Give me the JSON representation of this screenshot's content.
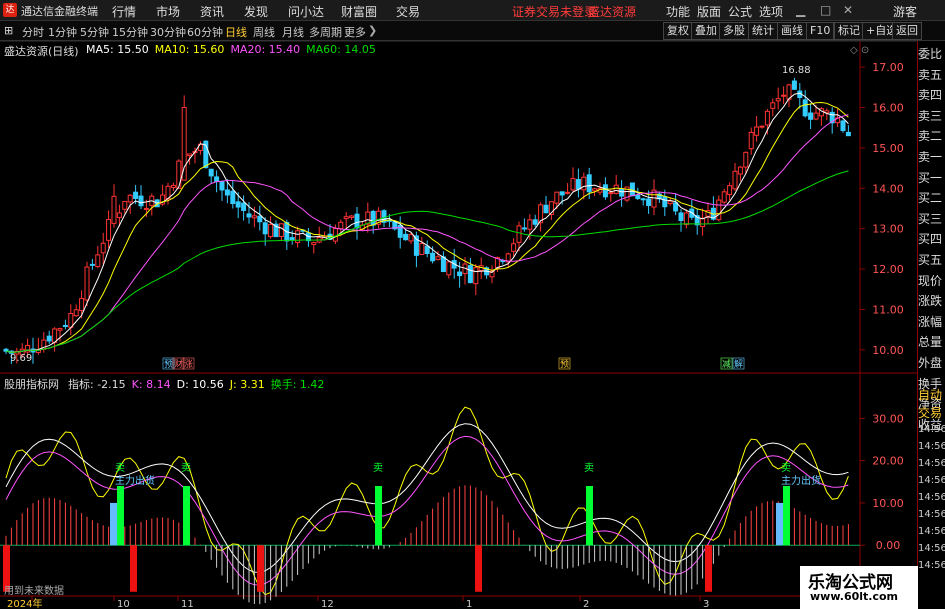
{
  "app": {
    "title": "通达信金融终端",
    "logo": "达",
    "status_alert": "证券交易未登录",
    "brand_link": "盛达资源",
    "user_button": "游客"
  },
  "menu": [
    "行情",
    "市场",
    "资讯",
    "发现",
    "问小达",
    "财富圈",
    "交易"
  ],
  "top_right": [
    "功能",
    "版面",
    "公式",
    "选项"
  ],
  "periods": [
    {
      "label": "分时",
      "active": false
    },
    {
      "label": "1分钟",
      "active": false
    },
    {
      "label": "5分钟",
      "active": false
    },
    {
      "label": "15分钟",
      "active": false
    },
    {
      "label": "30分钟",
      "active": false
    },
    {
      "label": "60分钟",
      "active": false
    },
    {
      "label": "日线",
      "active": true
    },
    {
      "label": "周线",
      "active": false
    },
    {
      "label": "月线",
      "active": false
    },
    {
      "label": "多周期",
      "active": false
    },
    {
      "label": "更多",
      "active": false
    }
  ],
  "toolbar_right": [
    "复权",
    "叠加",
    "多股",
    "统计",
    "画线",
    "F10",
    "标记",
    "+自选",
    "返回"
  ],
  "sidebar": [
    "委比",
    "卖五",
    "卖四",
    "卖三",
    "卖二",
    "卖一",
    "买一",
    "买二",
    "买三",
    "买四",
    "买五",
    "现价",
    "涨跌",
    "涨幅",
    "总量",
    "外盘",
    "换手",
    "净资",
    "收益"
  ],
  "sidebar_bottom": [
    "自动",
    "交易"
  ],
  "time_ticks": [
    "14:56",
    "14:56",
    "14:56",
    "14:56",
    "14:56",
    "14:56",
    "14:56",
    "14:56",
    "14:56"
  ],
  "colors": {
    "ma5": "#ffffff",
    "ma10": "#ffff00",
    "ma20": "#ff55ff",
    "ma60": "#00dd00",
    "up": "#ff3333",
    "down": "#33ccff",
    "axis": "#8b0000",
    "signal": "#00ff33"
  },
  "main_chart": {
    "stock_label": "盛达资源(日线)",
    "ma_labels": [
      {
        "text": "MA5: 15.50",
        "color": "#ffffff"
      },
      {
        "text": "MA10: 15.60",
        "color": "#ffff00"
      },
      {
        "text": "MA20: 15.40",
        "color": "#ff55ff"
      },
      {
        "text": "MA60: 14.05",
        "color": "#00dd00"
      }
    ],
    "y_ticks": [
      "17.00",
      "16.00",
      "15.00",
      "14.00",
      "13.00",
      "12.00",
      "11.00",
      "10.00"
    ],
    "high_label": "16.88",
    "low_label": "9.69",
    "markers": [
      "预",
      "财",
      "涨",
      "预",
      "减",
      "解"
    ]
  },
  "indicator": {
    "name": "股朋指标网",
    "values": [
      {
        "text": "指标: -2.15",
        "color": "#dddddd"
      },
      {
        "text": "K: 8.14",
        "color": "#ff55ff"
      },
      {
        "text": "D: 10.56",
        "color": "#ffffff"
      },
      {
        "text": "J: 3.31",
        "color": "#ffff00"
      },
      {
        "text": "换手: 1.42",
        "color": "#00dd00"
      }
    ],
    "y_ticks": [
      "30.00",
      "20.00",
      "10.00",
      "0.00"
    ],
    "sell_label": "卖",
    "chip_label": "主力出货",
    "footer_note": "用到未来数据"
  },
  "date_axis": [
    {
      "label": "2024年",
      "color": "#ffcc33"
    },
    {
      "label": "10",
      "color": "#ccc"
    },
    {
      "label": "11",
      "color": "#ccc"
    },
    {
      "label": "12",
      "color": "#ccc"
    },
    {
      "label": "1",
      "color": "#ccc"
    },
    {
      "label": "2",
      "color": "#ccc"
    },
    {
      "label": "3",
      "color": "#ccc"
    }
  ],
  "watermark": {
    "name": "乐淘公式网",
    "url": "www.60lt.com"
  }
}
